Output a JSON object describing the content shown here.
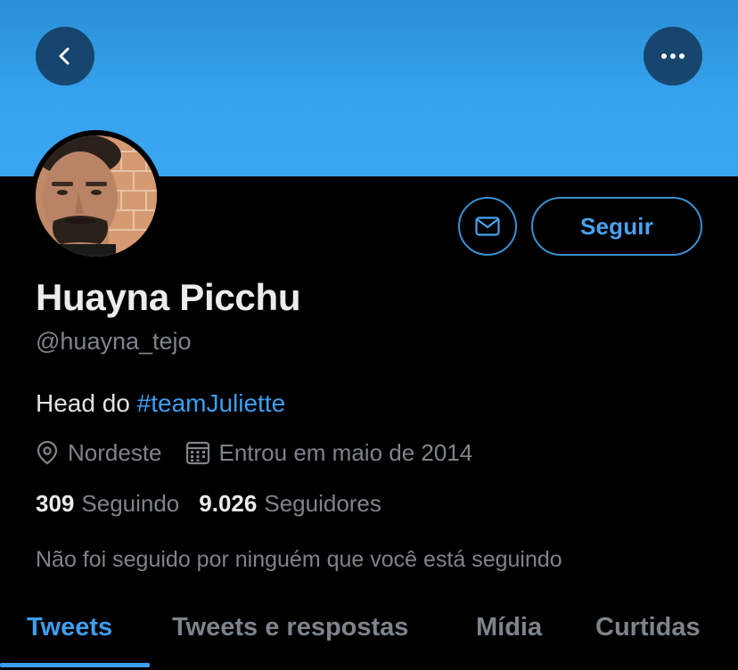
{
  "colors": {
    "banner": "#36a3ee",
    "accent": "#3d9ef0",
    "background": "#000000",
    "secondary_text": "#7d848b"
  },
  "header": {
    "back_icon": "chevron-left-icon",
    "more_icon": "more-dots-icon"
  },
  "profile": {
    "avatar_icon": "avatar-photo",
    "name": "Huayna Picchu",
    "handle": "@huayna_tejo",
    "bio_prefix": "Head do ",
    "bio_hashtag": "#teamJuliette",
    "location": "Nordeste",
    "location_icon": "location-pin-icon",
    "joined": "Entrou em maio de 2014",
    "joined_icon": "calendar-icon",
    "following_count": "309",
    "following_label": "Seguindo",
    "followers_count": "9.026",
    "followers_label": "Seguidores",
    "followed_by_note": "Não foi seguido por ninguém que você está seguindo"
  },
  "actions": {
    "message_icon": "envelope-icon",
    "follow_label": "Seguir"
  },
  "tabs": [
    {
      "label": "Tweets",
      "active": true
    },
    {
      "label": "Tweets e respostas",
      "active": false
    },
    {
      "label": "Mídia",
      "active": false
    },
    {
      "label": "Curtidas",
      "active": false
    }
  ]
}
